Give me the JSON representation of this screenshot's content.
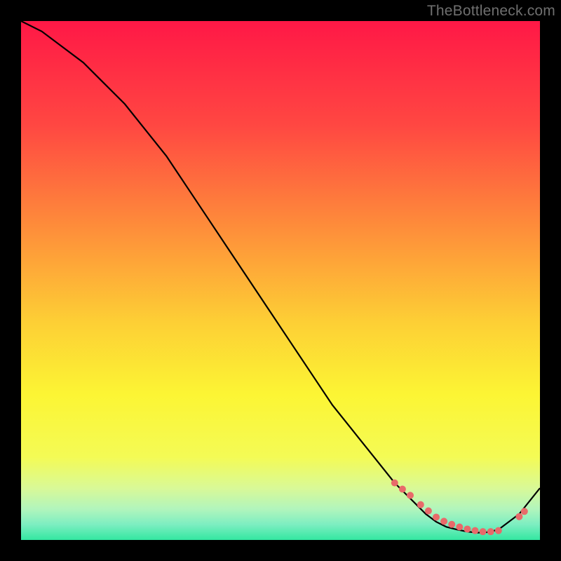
{
  "watermark": "TheBottleneck.com",
  "chart_data": {
    "type": "line",
    "title": "",
    "xlabel": "",
    "ylabel": "",
    "xlim": [
      0,
      100
    ],
    "ylim": [
      0,
      100
    ],
    "grid": false,
    "legend": false,
    "series": [
      {
        "name": "bottleneck-curve",
        "color": "#000000",
        "x": [
          0,
          4,
          8,
          12,
          16,
          20,
          24,
          28,
          32,
          36,
          40,
          44,
          48,
          52,
          56,
          60,
          64,
          68,
          72,
          74,
          76,
          78,
          80,
          82,
          84,
          86,
          88,
          90,
          92,
          96,
          100
        ],
        "y": [
          100,
          98,
          95,
          92,
          88,
          84,
          79,
          74,
          68,
          62,
          56,
          50,
          44,
          38,
          32,
          26,
          21,
          16,
          11,
          9,
          7,
          5,
          3.5,
          2.5,
          2,
          1.6,
          1.4,
          1.5,
          2,
          5,
          10
        ]
      }
    ],
    "markers": [
      {
        "name": "highlight-dots",
        "color": "#e86a6a",
        "x": [
          72,
          73.5,
          75,
          77,
          78.5,
          80,
          81.5,
          83,
          84.5,
          86,
          87.5,
          89,
          90.5,
          92,
          96,
          97
        ],
        "y": [
          11,
          9.8,
          8.6,
          6.8,
          5.6,
          4.4,
          3.6,
          3.0,
          2.5,
          2.1,
          1.8,
          1.6,
          1.6,
          1.8,
          4.5,
          5.5
        ]
      }
    ],
    "background_gradient": {
      "stops": [
        {
          "offset": 0.0,
          "color": "#ff1846"
        },
        {
          "offset": 0.2,
          "color": "#ff4742"
        },
        {
          "offset": 0.4,
          "color": "#fe8e3a"
        },
        {
          "offset": 0.58,
          "color": "#fdcf35"
        },
        {
          "offset": 0.72,
          "color": "#fcf534"
        },
        {
          "offset": 0.84,
          "color": "#f4fb55"
        },
        {
          "offset": 0.9,
          "color": "#d9f997"
        },
        {
          "offset": 0.94,
          "color": "#b2f5bc"
        },
        {
          "offset": 0.97,
          "color": "#7deec1"
        },
        {
          "offset": 1.0,
          "color": "#33e7a1"
        }
      ]
    }
  }
}
